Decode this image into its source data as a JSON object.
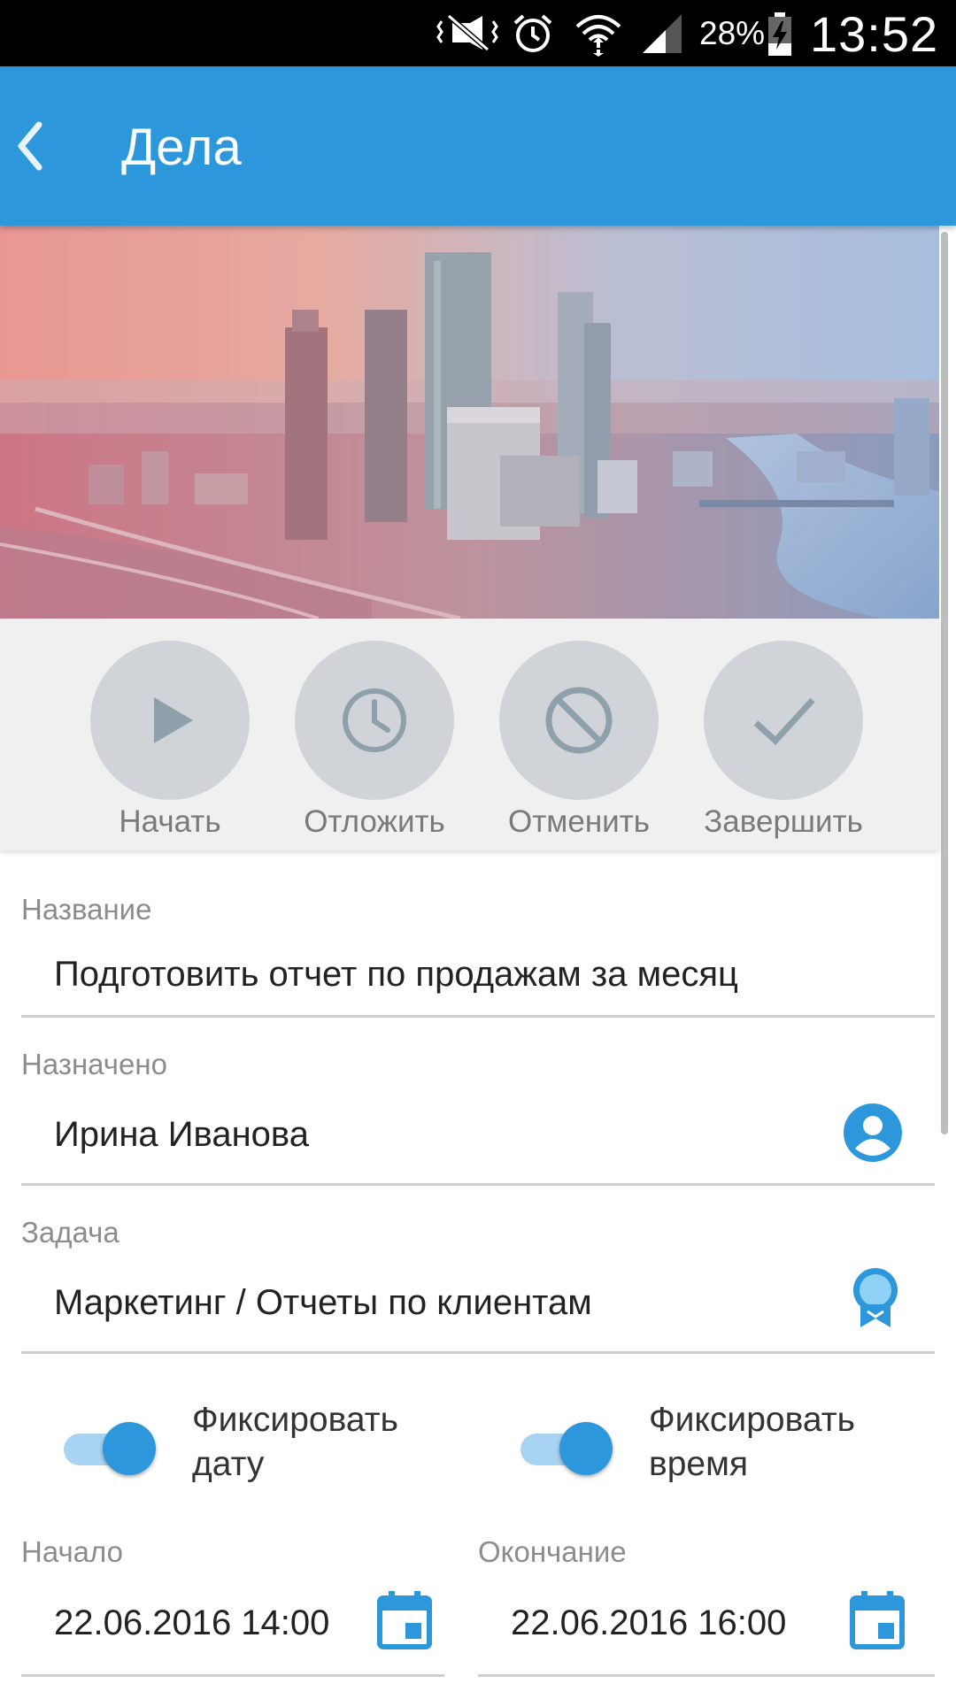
{
  "status_bar": {
    "battery_percent": "28%",
    "time": "13:52",
    "icons": [
      "mute-vibrate-icon",
      "alarm-icon",
      "wifi-icon",
      "signal-icon",
      "battery-charging-icon"
    ]
  },
  "app_bar": {
    "title": "Дела",
    "back_icon": "chevron-left-icon",
    "color": "#2d97dc"
  },
  "actions": [
    {
      "label": "Начать",
      "icon": "play-icon"
    },
    {
      "label": "Отложить",
      "icon": "clock-icon"
    },
    {
      "label": "Отменить",
      "icon": "cancel-icon"
    },
    {
      "label": "Завершить",
      "icon": "check-icon"
    }
  ],
  "form": {
    "name": {
      "caption": "Название",
      "value": "Подготовить отчет по продажам за месяц"
    },
    "assigned": {
      "caption": "Назначено",
      "value": "Ирина Иванова",
      "icon": "account-circle-icon"
    },
    "task": {
      "caption": "Задача",
      "value": "Маркетинг / Отчеты по клиентам",
      "icon": "award-icon"
    },
    "fix_date": {
      "line1": "Фиксировать",
      "line2": "дату",
      "checked": true
    },
    "fix_time": {
      "line1": "Фиксировать",
      "line2": "время",
      "checked": true
    },
    "start": {
      "caption": "Начало",
      "value": "22.06.2016 14:00",
      "icon": "calendar-icon"
    },
    "end": {
      "caption": "Окончание",
      "value": "22.06.2016 16:00",
      "icon": "calendar-icon"
    }
  },
  "colors": {
    "accent": "#2d97dc",
    "action_circle": "#d0d4d8",
    "action_icon": "#8ea1ab"
  }
}
